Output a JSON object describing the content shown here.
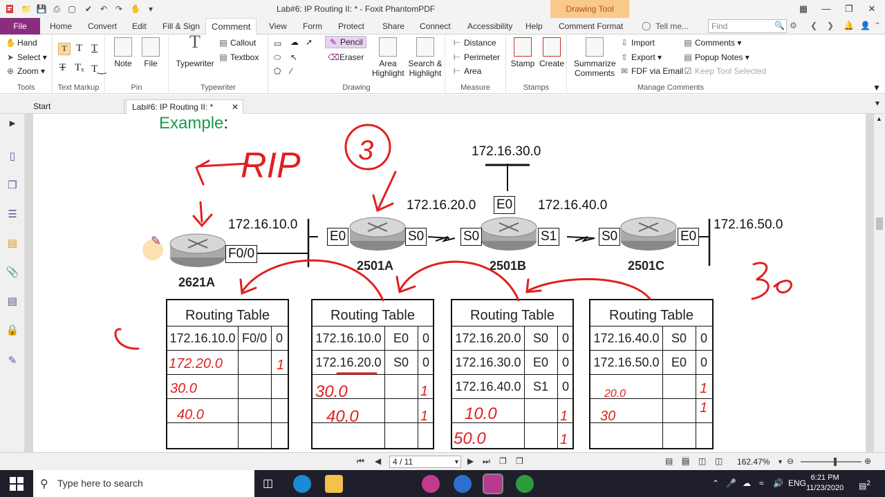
{
  "window": {
    "title": "Lab#6: IP Routing II: * - Foxit PhantomPDF",
    "context_tab": "Drawing Tool"
  },
  "tabs": {
    "file": "File",
    "items": [
      "Home",
      "Convert",
      "Edit",
      "Fill & Sign",
      "Comment",
      "View",
      "Form",
      "Protect",
      "Share",
      "Connect",
      "Accessibility",
      "Help",
      "Comment Format"
    ],
    "active": "Comment",
    "tell_me": "Tell me...",
    "find_placeholder": "Find"
  },
  "ribbon": {
    "tools": {
      "label": "Tools",
      "hand": "Hand",
      "select": "Select",
      "zoom": "Zoom"
    },
    "text_markup": {
      "label": "Text Markup"
    },
    "pin": {
      "label": "Pin",
      "note": "Note",
      "file": "File"
    },
    "typewriter": {
      "label": "Typewriter",
      "typewriter": "Typewriter",
      "callout": "Callout",
      "textbox": "Textbox"
    },
    "drawing": {
      "label": "Drawing",
      "pencil": "Pencil",
      "eraser": "Eraser",
      "area_highlight": "Area\nHighlight",
      "search_highlight": "Search &\nHighlight"
    },
    "measure": {
      "label": "Measure",
      "distance": "Distance",
      "perimeter": "Perimeter",
      "area": "Area"
    },
    "stamps": {
      "label": "Stamps",
      "stamp": "Stamp",
      "create": "Create"
    },
    "manage": {
      "label": "Manage Comments",
      "summarize": "Summarize\nComments",
      "import": "Import",
      "export": "Export",
      "fdf": "FDF via Email",
      "comments": "Comments",
      "popup": "Popup Notes",
      "keep": "Keep Tool Selected"
    }
  },
  "doctabs": {
    "start": "Start",
    "active": "Lab#6: IP Routing II: *"
  },
  "document": {
    "title": "Example",
    "title_colon": ":",
    "networks": [
      "172.16.10.0",
      "172.16.20.0",
      "172.16.30.0",
      "172.16.40.0",
      "172.16.50.0"
    ],
    "interfaces": {
      "f00": "F0/0",
      "e0a": "E0",
      "s0a": "S0",
      "s0b": "S0",
      "e0b": "E0",
      "s1b": "S1",
      "s0c": "S0",
      "e0c": "E0"
    },
    "routers": [
      "2621A",
      "2501A",
      "2501B",
      "2501C"
    ],
    "routing_tables": [
      {
        "title": "Routing Table",
        "rows": [
          [
            "172.16.10.0",
            "F0/0",
            "0"
          ],
          [
            "",
            "",
            ""
          ],
          [
            "",
            "",
            ""
          ],
          [
            "",
            "",
            ""
          ],
          [
            "",
            "",
            ""
          ]
        ]
      },
      {
        "title": "Routing Table",
        "rows": [
          [
            "172.16.10.0",
            "E0",
            "0"
          ],
          [
            "172.16.20.0",
            "S0",
            "0"
          ],
          [
            "",
            "",
            ""
          ],
          [
            "",
            "",
            ""
          ],
          [
            "",
            "",
            ""
          ]
        ]
      },
      {
        "title": "Routing Table",
        "rows": [
          [
            "172.16.20.0",
            "S0",
            "0"
          ],
          [
            "172.16.30.0",
            "E0",
            "0"
          ],
          [
            "172.16.40.0",
            "S1",
            "0"
          ],
          [
            "",
            "",
            ""
          ],
          [
            "",
            "",
            ""
          ]
        ]
      },
      {
        "title": "Routing Table",
        "rows": [
          [
            "172.16.40.0",
            "S0",
            "0"
          ],
          [
            "172.16.50.0",
            "E0",
            "0"
          ],
          [
            "",
            "",
            ""
          ],
          [
            "",
            "",
            ""
          ],
          [
            "",
            "",
            ""
          ]
        ]
      }
    ],
    "annotations": {
      "rip": "RIP",
      "circle_3": "3",
      "thirty": "30",
      "c": "C",
      "t1_r2": "172.20.0",
      "t1_r2_hop": "1",
      "t1_r3": "30.0",
      "t1_r4": "40.0",
      "t2_r3": "30.0",
      "t2_r3_hop": "1",
      "t2_r4": "40.0",
      "t2_r4_hop": "1",
      "t3_r4": "10.0",
      "t3_r4_hop": "1",
      "t3_r5": "50.0",
      "t3_r5_hop": "1",
      "t4_r3": "20.0",
      "t4_r3_hop": "1",
      "t4_r4": "30",
      "t4_r4_hop": "1"
    }
  },
  "statusbar": {
    "page": "4 / 11",
    "zoom": "162.47%"
  },
  "taskbar": {
    "search": "Type here to search",
    "lang": "ENG",
    "time": "6:21 PM",
    "date": "11/23/2020",
    "notif": "2"
  }
}
